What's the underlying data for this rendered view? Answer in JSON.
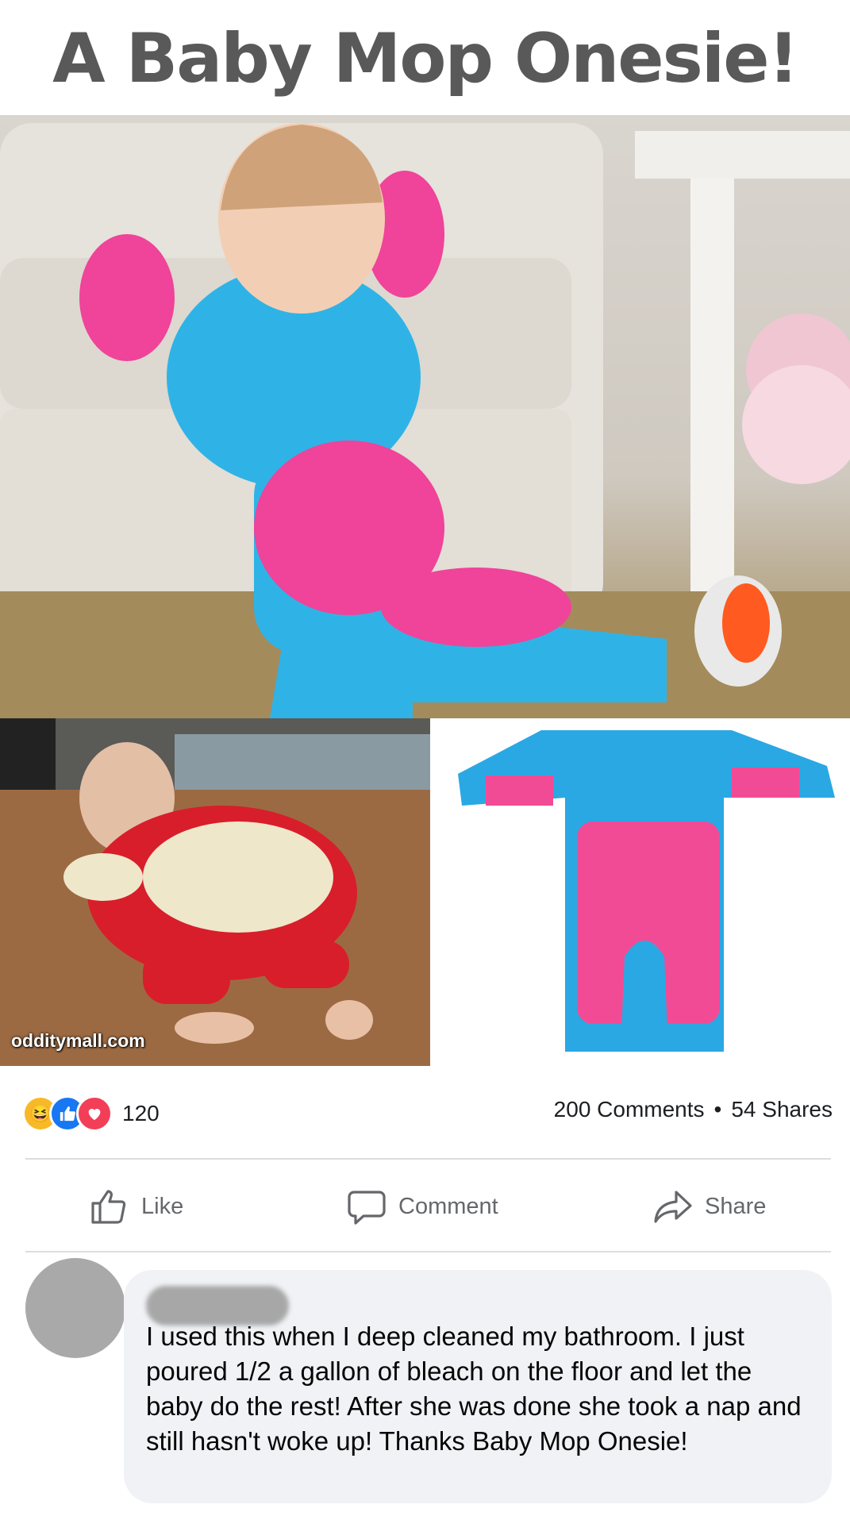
{
  "header": {
    "title": "A Baby Mop Onesie!"
  },
  "photos": {
    "main_alt": "baby-in-blue-mop-onesie",
    "crawl_watermark": "odditymall.com"
  },
  "post_stats": {
    "reactions": [
      "haha",
      "like",
      "love"
    ],
    "reaction_count": "120",
    "comments": "200 Comments",
    "separator": "•",
    "shares": "54 Shares"
  },
  "actions": {
    "like": "Like",
    "comment": "Comment",
    "share": "Share"
  },
  "comment": {
    "text": "I used this when I deep cleaned my bathroom. I just poured 1/2 a gallon of bleach on the floor and let the baby do the rest! After she was done she took a nap and still hasn't woke up! Thanks Baby Mop Onesie!"
  },
  "colors": {
    "like_blue": "#1877f2",
    "love_red": "#f33e58",
    "haha_yellow": "#f7b928",
    "muted_text": "#65676b",
    "bubble_bg": "#f0f2f5"
  }
}
